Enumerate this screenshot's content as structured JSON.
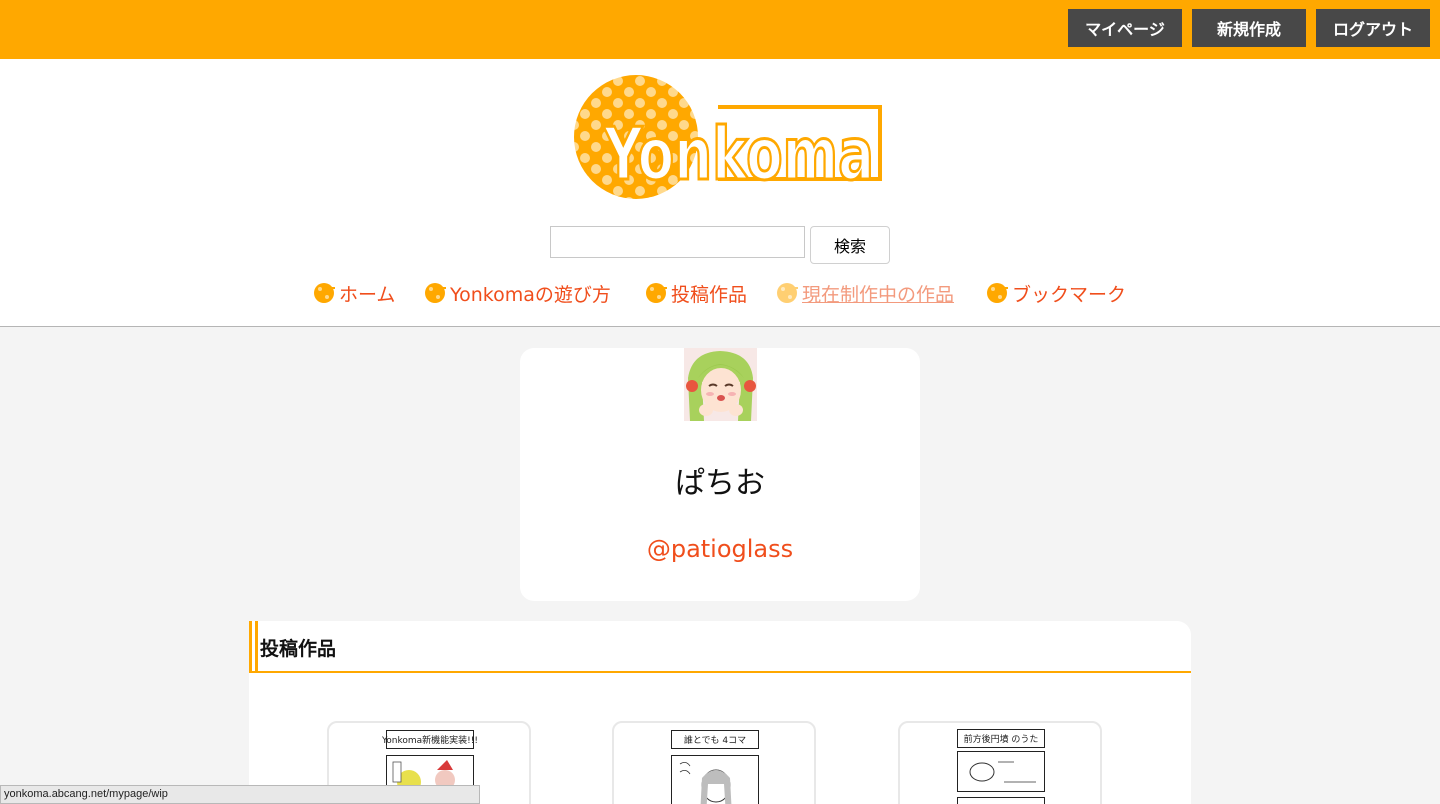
{
  "topbar": {
    "mypage_label": "マイページ",
    "new_label": "新規作成",
    "logout_label": "ログアウト",
    "accent_color": "#ffa800",
    "button_color": "#484848"
  },
  "header": {
    "logo_text": "Yonkoma",
    "search": {
      "value": "",
      "button_label": "検索"
    }
  },
  "nav": {
    "items": [
      {
        "label": "ホーム",
        "icon": "yonkoma-logo-icon"
      },
      {
        "label": "Yonkomaの遊び方",
        "icon": "yonkoma-logo-icon"
      },
      {
        "label": "投稿作品",
        "icon": "yonkoma-logo-icon"
      },
      {
        "label": "現在制作中の作品",
        "icon": "yonkoma-logo-icon",
        "state": "hovered"
      },
      {
        "label": "ブックマーク",
        "icon": "yonkoma-logo-icon"
      }
    ],
    "link_color": "#f04e1c"
  },
  "profile": {
    "name": "ぱちお",
    "handle": "@patioglass",
    "avatar": "avatar-image"
  },
  "works": {
    "title": "投稿作品",
    "items": [
      {
        "panel_title": "Yonkoma新機能実装!!!"
      },
      {
        "panel_title": "誰とでも 4コマ"
      },
      {
        "panel_title": "前方後円墳 のうた"
      }
    ]
  },
  "statusbar": {
    "url": "yonkoma.abcang.net/mypage/wip"
  }
}
